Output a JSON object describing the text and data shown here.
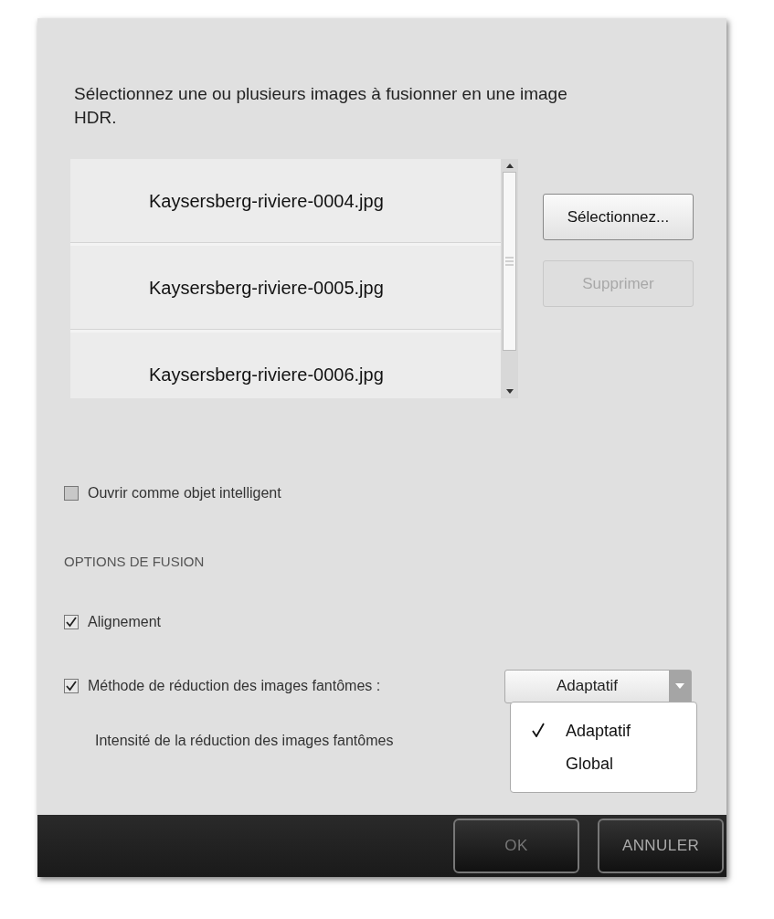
{
  "intro": "Sélectionnez une ou plusieurs images à fusionner en une image HDR.",
  "files": [
    "Kaysersberg-riviere-0004.jpg",
    "Kaysersberg-riviere-0005.jpg",
    "Kaysersberg-riviere-0006.jpg"
  ],
  "file_buttons": [
    {
      "label": "Sélectionnez...",
      "disabled": false
    },
    {
      "label": "Supprimer",
      "disabled": true
    }
  ],
  "smart_object": {
    "label": "Ouvrir comme objet intelligent",
    "checked": false
  },
  "section_title": "OPTIONS DE FUSION",
  "alignment": {
    "label": "Alignement",
    "checked": true
  },
  "ghost_method": {
    "label": "Méthode de réduction des images fantômes :",
    "checked": true,
    "value": "Adaptatif"
  },
  "intensity_label": "Intensité de la réduction des images fantômes",
  "menu_items": [
    {
      "label": "Adaptatif",
      "selected": true
    },
    {
      "label": "Global",
      "selected": false
    }
  ],
  "footer_buttons": [
    "OK",
    "ANNULER"
  ]
}
